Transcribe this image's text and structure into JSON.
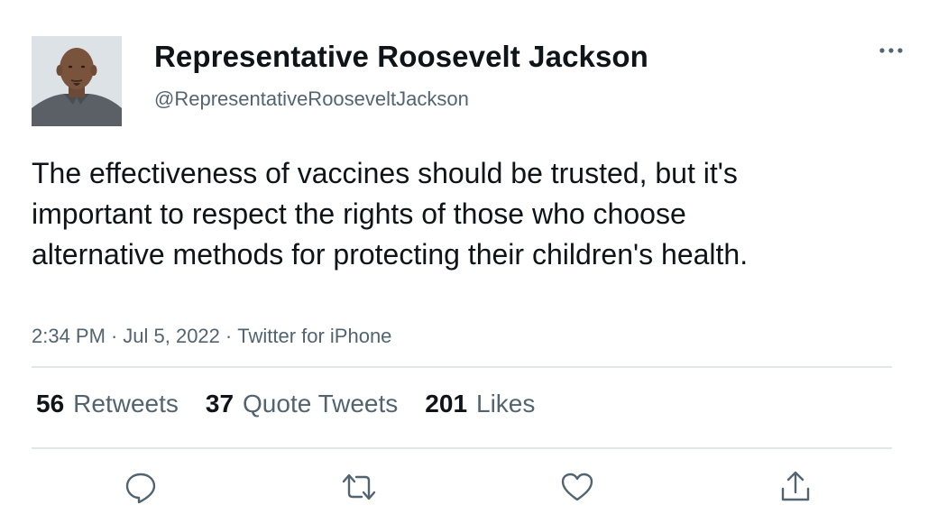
{
  "author": {
    "display_name": "Representative Roosevelt Jackson",
    "handle": "@RepresentativeRooseveltJackson",
    "avatar_icon": "person-photo-avatar"
  },
  "tweet": {
    "text": "The effectiveness of vaccines should be trusted, but it's important to respect the rights of those who choose alternative methods for protecting their children's health.",
    "time": "2:34 PM",
    "date": "Jul 5, 2022",
    "source": "Twitter for iPhone",
    "separator": "·"
  },
  "stats": {
    "retweets": {
      "count": "56",
      "label": "Retweets"
    },
    "quote_tweets": {
      "count": "37",
      "label": "Quote Tweets"
    },
    "likes": {
      "count": "201",
      "label": "Likes"
    }
  },
  "actions": {
    "reply_icon": "reply-icon",
    "retweet_icon": "retweet-icon",
    "like_icon": "like-heart-icon",
    "share_icon": "share-icon",
    "more_icon": "more-options-icon"
  },
  "colors": {
    "text_primary": "#0f1419",
    "text_secondary": "#536471",
    "divider": "#e1e6e9",
    "icon": "#536471"
  }
}
